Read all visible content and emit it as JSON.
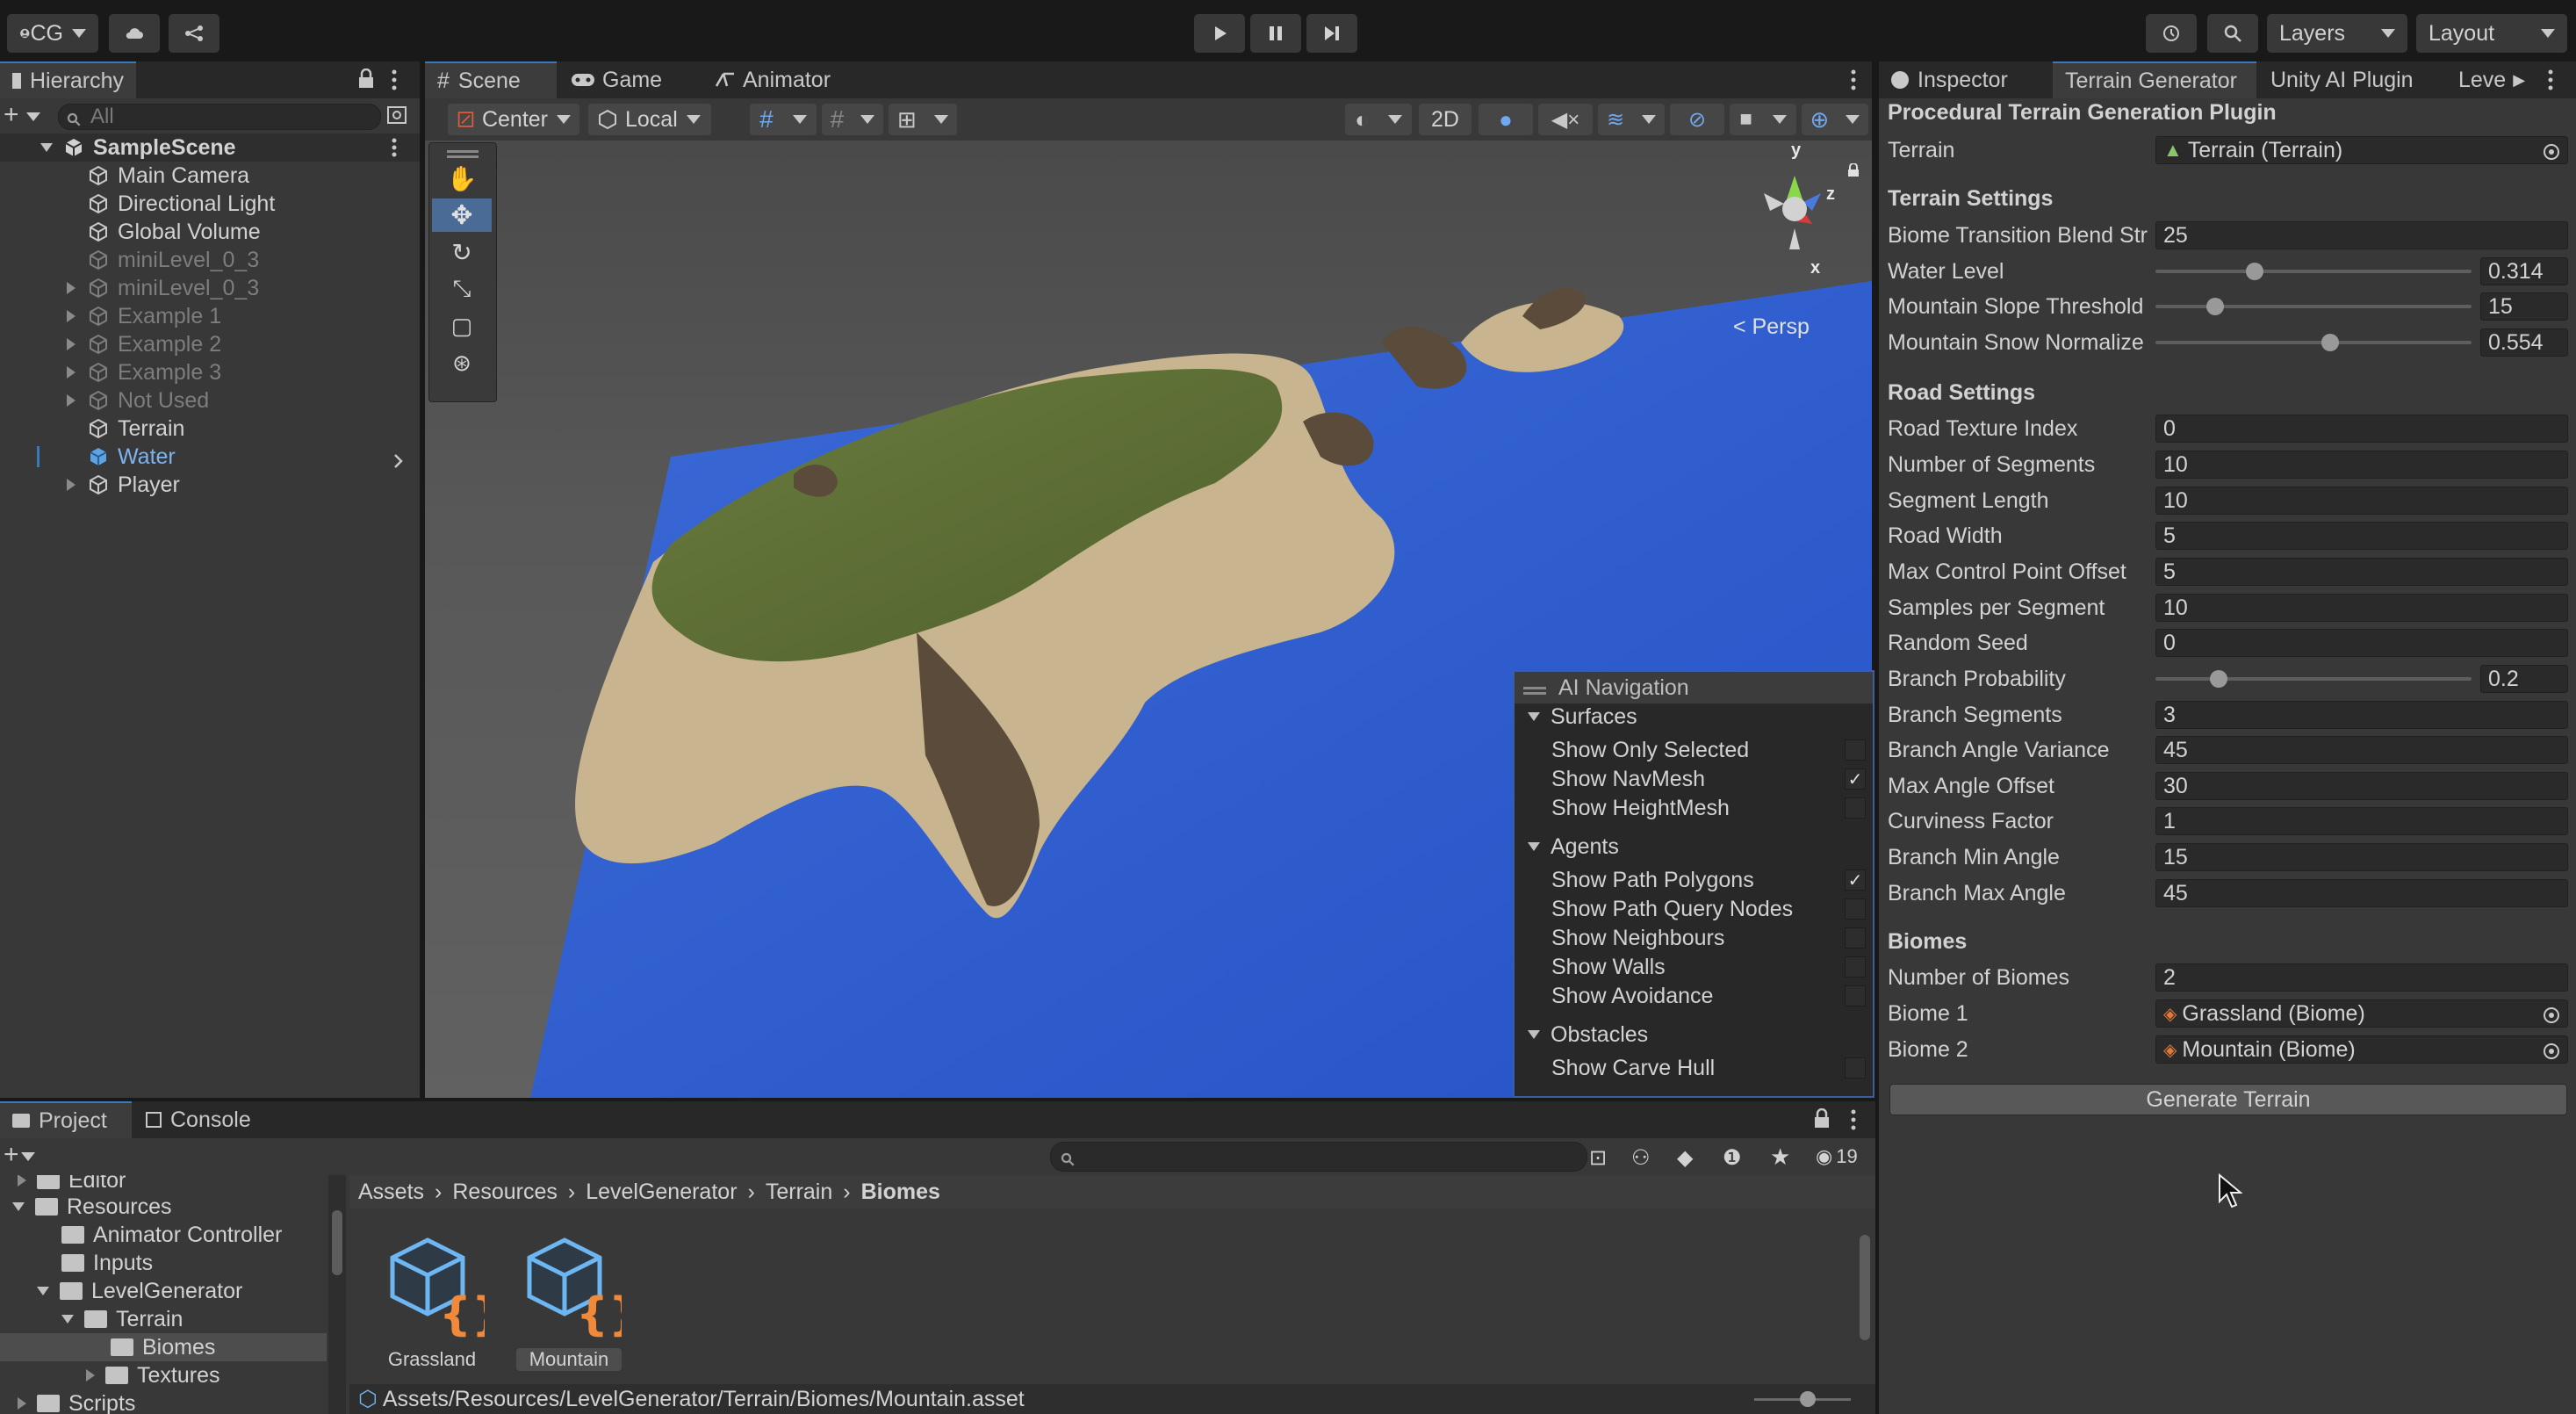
{
  "toolbar": {
    "account": "CG",
    "layers": "Layers",
    "layout": "Layout"
  },
  "hierarchy": {
    "tab": "Hierarchy",
    "search_placeholder": "All",
    "items": [
      {
        "label": "SampleScene"
      },
      {
        "label": "Main Camera"
      },
      {
        "label": "Directional Light"
      },
      {
        "label": "Global Volume"
      },
      {
        "label": "miniLevel_0_3"
      },
      {
        "label": "miniLevel_0_3"
      },
      {
        "label": "Example 1"
      },
      {
        "label": "Example 2"
      },
      {
        "label": "Example 3"
      },
      {
        "label": "Not Used"
      },
      {
        "label": "Terrain"
      },
      {
        "label": "Water"
      },
      {
        "label": "Player"
      }
    ]
  },
  "scene": {
    "tabs": [
      "Scene",
      "Game",
      "Animator"
    ],
    "pivot": "Center",
    "space": "Local",
    "mode_2d": "2D",
    "persp": "< Persp",
    "gizmo_axes": {
      "y": "y",
      "z": "z",
      "x": "x"
    }
  },
  "ai_nav": {
    "title": "AI Navigation",
    "groups": [
      {
        "label": "Surfaces",
        "items": [
          {
            "label": "Show Only Selected",
            "checked": false
          },
          {
            "label": "Show NavMesh",
            "checked": true
          },
          {
            "label": "Show HeightMesh",
            "checked": false
          }
        ]
      },
      {
        "label": "Agents",
        "items": [
          {
            "label": "Show Path Polygons",
            "checked": true
          },
          {
            "label": "Show Path Query Nodes",
            "checked": false
          },
          {
            "label": "Show Neighbours",
            "checked": false
          },
          {
            "label": "Show Walls",
            "checked": false
          },
          {
            "label": "Show Avoidance",
            "checked": false
          }
        ]
      },
      {
        "label": "Obstacles",
        "items": [
          {
            "label": "Show Carve Hull",
            "checked": false
          }
        ]
      }
    ]
  },
  "inspector": {
    "tabs": [
      "Inspector",
      "Terrain Generator",
      "Unity AI Plugin",
      "Leve"
    ],
    "header": "Procedural Terrain Generation Plugin",
    "terrain_label": "Terrain",
    "terrain_value": "Terrain (Terrain)",
    "terrain_settings": {
      "title": "Terrain Settings",
      "biome_blend_label": "Biome Transition Blend Str",
      "biome_blend_value": "25",
      "water_level_label": "Water Level",
      "water_level_value": "0.314",
      "water_level_fraction": 0.314,
      "slope_label": "Mountain Slope Threshold",
      "slope_value": "15",
      "slope_fraction": 0.19,
      "snow_label": "Mountain Snow Normalize",
      "snow_value": "0.554",
      "snow_fraction": 0.554
    },
    "road_settings": {
      "title": "Road Settings",
      "fields": [
        {
          "label": "Road Texture Index",
          "value": "0"
        },
        {
          "label": "Number of Segments",
          "value": "10"
        },
        {
          "label": "Segment Length",
          "value": "10"
        },
        {
          "label": "Road Width",
          "value": "5"
        },
        {
          "label": "Max Control Point Offset",
          "value": "5"
        },
        {
          "label": "Samples per Segment",
          "value": "10"
        },
        {
          "label": "Random Seed",
          "value": "0"
        }
      ],
      "branch_prob_label": "Branch Probability",
      "branch_prob_value": "0.2",
      "branch_prob_fraction": 0.2,
      "fields2": [
        {
          "label": "Branch Segments",
          "value": "3"
        },
        {
          "label": "Branch Angle Variance",
          "value": "45"
        },
        {
          "label": "Max Angle Offset",
          "value": "30"
        },
        {
          "label": "Curviness Factor",
          "value": "1"
        },
        {
          "label": "Branch Min Angle",
          "value": "15"
        },
        {
          "label": "Branch Max Angle",
          "value": "45"
        }
      ]
    },
    "biomes": {
      "title": "Biomes",
      "count_label": "Number of Biomes",
      "count_value": "2",
      "biome1_label": "Biome 1",
      "biome1_value": "Grassland (Biome)",
      "biome2_label": "Biome 2",
      "biome2_value": "Mountain (Biome)"
    },
    "generate_button": "Generate Terrain"
  },
  "project": {
    "tabs": [
      "Project",
      "Console"
    ],
    "count": "19",
    "tree": [
      {
        "label": "Editor"
      },
      {
        "label": "Resources"
      },
      {
        "label": "Animator Controller"
      },
      {
        "label": "Inputs"
      },
      {
        "label": "LevelGenerator"
      },
      {
        "label": "Terrain"
      },
      {
        "label": "Biomes"
      },
      {
        "label": "Textures"
      },
      {
        "label": "Scripts"
      }
    ],
    "breadcrumb": [
      "Assets",
      "Resources",
      "LevelGenerator",
      "Terrain",
      "Biomes"
    ],
    "assets": [
      {
        "label": "Grassland"
      },
      {
        "label": "Mountain"
      }
    ],
    "path": "Assets/Resources/LevelGenerator/Terrain/Biomes/Mountain.asset"
  }
}
